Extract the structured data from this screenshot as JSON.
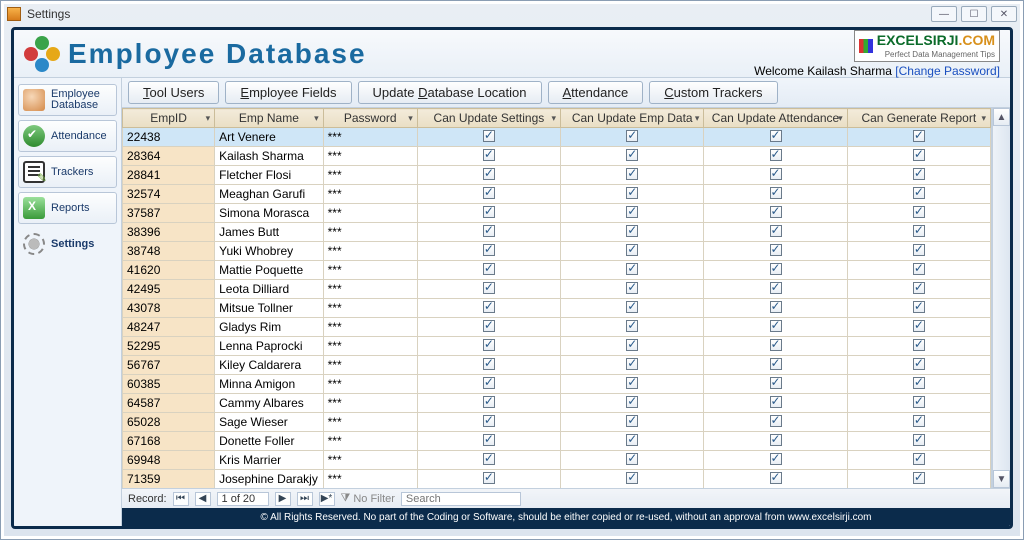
{
  "window": {
    "title": "Settings"
  },
  "header": {
    "appTitle": "Employee Database",
    "brandMain": "EXCELSIRJI",
    "brandDot": ".COM",
    "brandSub": "Perfect Data Management Tips",
    "welcome": "Welcome Kailash Sharma",
    "changePassword": "[Change Password]"
  },
  "sidebar": {
    "items": [
      {
        "label": "Employee Database"
      },
      {
        "label": "Attendance"
      },
      {
        "label": "Trackers"
      },
      {
        "label": "Reports"
      },
      {
        "label": "Settings"
      }
    ]
  },
  "tabs": {
    "toolUsers": "Tool Users",
    "employeeFields": "Employee Fields",
    "updateDbLoc": "Update Database Location",
    "attendance": "Attendance",
    "customTrackers": "Custom Trackers"
  },
  "grid": {
    "columns": [
      "EmpID",
      "Emp Name",
      "Password",
      "Can Update Settings",
      "Can Update Emp Data",
      "Can Update Attendance",
      "Can Generate Report"
    ],
    "rows": [
      {
        "empId": "22438",
        "name": "Art Venere",
        "pw": "***",
        "c1": true,
        "c2": true,
        "c3": true,
        "c4": true
      },
      {
        "empId": "28364",
        "name": "Kailash Sharma",
        "pw": "***",
        "c1": true,
        "c2": true,
        "c3": true,
        "c4": true
      },
      {
        "empId": "28841",
        "name": "Fletcher Flosi",
        "pw": "***",
        "c1": true,
        "c2": true,
        "c3": true,
        "c4": true
      },
      {
        "empId": "32574",
        "name": "Meaghan Garufi",
        "pw": "***",
        "c1": true,
        "c2": true,
        "c3": true,
        "c4": true
      },
      {
        "empId": "37587",
        "name": "Simona Morasca",
        "pw": "***",
        "c1": true,
        "c2": true,
        "c3": true,
        "c4": true
      },
      {
        "empId": "38396",
        "name": "James Butt",
        "pw": "***",
        "c1": true,
        "c2": true,
        "c3": true,
        "c4": true
      },
      {
        "empId": "38748",
        "name": "Yuki Whobrey",
        "pw": "***",
        "c1": true,
        "c2": true,
        "c3": true,
        "c4": true
      },
      {
        "empId": "41620",
        "name": "Mattie Poquette",
        "pw": "***",
        "c1": true,
        "c2": true,
        "c3": true,
        "c4": true
      },
      {
        "empId": "42495",
        "name": "Leota Dilliard",
        "pw": "***",
        "c1": true,
        "c2": true,
        "c3": true,
        "c4": true
      },
      {
        "empId": "43078",
        "name": "Mitsue Tollner",
        "pw": "***",
        "c1": true,
        "c2": true,
        "c3": true,
        "c4": true
      },
      {
        "empId": "48247",
        "name": "Gladys Rim",
        "pw": "***",
        "c1": true,
        "c2": true,
        "c3": true,
        "c4": true
      },
      {
        "empId": "52295",
        "name": "Lenna Paprocki",
        "pw": "***",
        "c1": true,
        "c2": true,
        "c3": true,
        "c4": true
      },
      {
        "empId": "56767",
        "name": "Kiley Caldarera",
        "pw": "***",
        "c1": true,
        "c2": true,
        "c3": true,
        "c4": true
      },
      {
        "empId": "60385",
        "name": "Minna Amigon",
        "pw": "***",
        "c1": true,
        "c2": true,
        "c3": true,
        "c4": true
      },
      {
        "empId": "64587",
        "name": "Cammy Albares",
        "pw": "***",
        "c1": true,
        "c2": true,
        "c3": true,
        "c4": true
      },
      {
        "empId": "65028",
        "name": "Sage Wieser",
        "pw": "***",
        "c1": true,
        "c2": true,
        "c3": true,
        "c4": true
      },
      {
        "empId": "67168",
        "name": "Donette Foller",
        "pw": "***",
        "c1": true,
        "c2": true,
        "c3": true,
        "c4": true
      },
      {
        "empId": "69948",
        "name": "Kris Marrier",
        "pw": "***",
        "c1": true,
        "c2": true,
        "c3": true,
        "c4": true
      },
      {
        "empId": "71359",
        "name": "Josephine Darakjy",
        "pw": "***",
        "c1": true,
        "c2": true,
        "c3": true,
        "c4": true
      }
    ]
  },
  "recordNav": {
    "label": "Record:",
    "position": "1 of 20",
    "noFilter": "No Filter",
    "searchPlaceholder": "Search"
  },
  "footer": "© All Rights Reserved. No part of the Coding or Software, should be either copied or re-used, without an approval from www.excelsirji.com"
}
